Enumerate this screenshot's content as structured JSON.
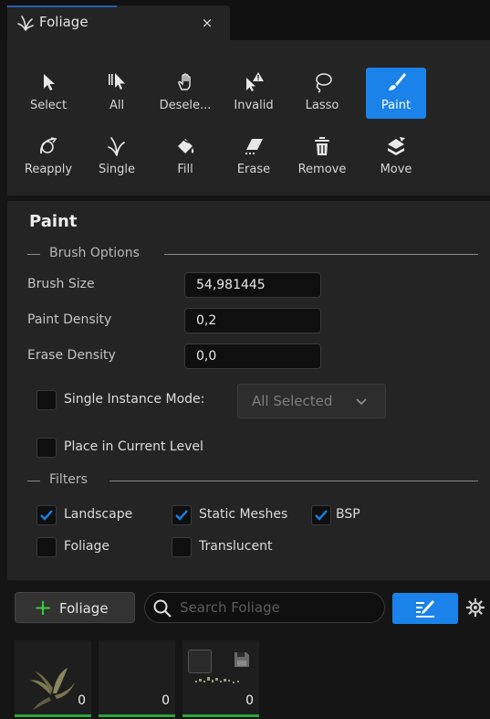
{
  "tab": {
    "title": "Foliage",
    "close": "×"
  },
  "tools": [
    {
      "id": "select",
      "label": "Select",
      "icon": "arrow-cursor-icon",
      "active": false
    },
    {
      "id": "all",
      "label": "All",
      "icon": "select-all-icon",
      "active": false
    },
    {
      "id": "deselect",
      "label": "Desele...",
      "icon": "hand-deselect-icon",
      "active": false
    },
    {
      "id": "invalid",
      "label": "Invalid",
      "icon": "invalid-select-icon",
      "active": false
    },
    {
      "id": "lasso",
      "label": "Lasso",
      "icon": "lasso-icon",
      "active": false
    },
    {
      "id": "paint",
      "label": "Paint",
      "icon": "paint-brush-icon",
      "active": true
    },
    {
      "id": "reapply",
      "label": "Reapply",
      "icon": "reapply-icon",
      "active": false
    },
    {
      "id": "single",
      "label": "Single",
      "icon": "single-plant-icon",
      "active": false
    },
    {
      "id": "fill",
      "label": "Fill",
      "icon": "fill-bucket-icon",
      "active": false
    },
    {
      "id": "erase",
      "label": "Erase",
      "icon": "eraser-icon",
      "active": false
    },
    {
      "id": "remove",
      "label": "Remove",
      "icon": "trash-icon",
      "active": false
    },
    {
      "id": "move",
      "label": "Move",
      "icon": "move-icon",
      "active": false
    }
  ],
  "panel": {
    "title": "Paint",
    "brush_options": {
      "header": "Brush Options",
      "brush_size": {
        "label": "Brush Size",
        "value": "54,981445"
      },
      "paint_density": {
        "label": "Paint Density",
        "value": "0,2"
      },
      "erase_density": {
        "label": "Erase Density",
        "value": "0,0"
      },
      "single_instance": {
        "label": "Single Instance Mode:",
        "checked": false,
        "option": "All Selected"
      },
      "place_in_level": {
        "label": "Place in Current Level",
        "checked": false
      }
    },
    "filters": {
      "header": "Filters",
      "items": [
        {
          "label": "Landscape",
          "checked": true
        },
        {
          "label": "Static Meshes",
          "checked": true
        },
        {
          "label": "BSP",
          "checked": true
        },
        {
          "label": "Foliage",
          "checked": false
        },
        {
          "label": "Translucent",
          "checked": false
        }
      ]
    }
  },
  "bottom": {
    "add_label": "Foliage",
    "search_placeholder": "Search Foliage"
  },
  "foliage_types": [
    {
      "count": "0"
    },
    {
      "count": "0"
    },
    {
      "count": "0"
    }
  ],
  "colors": {
    "accent": "#1a82e8",
    "add_green": "#3ecc3e",
    "bar_green": "#2ea33a"
  }
}
